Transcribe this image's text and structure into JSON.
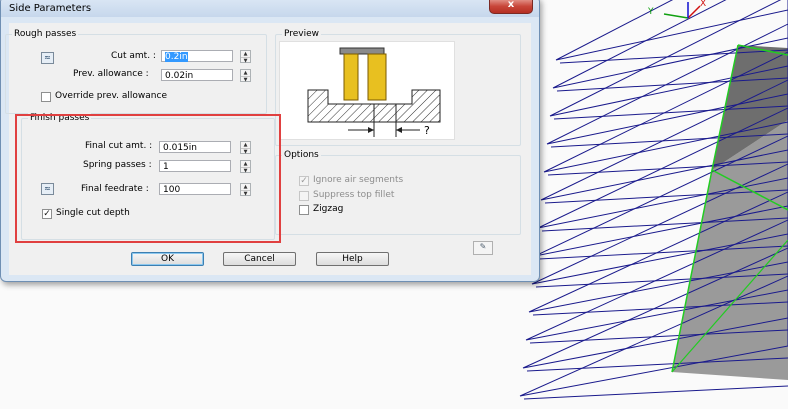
{
  "dialog": {
    "title": "Side Parameters",
    "close_label": "x"
  },
  "rough": {
    "title": "Rough passes",
    "cut_amt_label": "Cut amt. :",
    "cut_amt_value": "0.2in",
    "prev_allowance_label": "Prev. allowance :",
    "prev_allowance_value": "0.02in",
    "override_label": "Override prev. allowance",
    "override_checked": false
  },
  "preview": {
    "title": "Preview",
    "question_mark": "?"
  },
  "finish": {
    "title": "Finish passes",
    "final_cut_label": "Final cut amt. :",
    "final_cut_value": "0.015in",
    "spring_label": "Spring passes :",
    "spring_value": "1",
    "feedrate_label": "Final feedrate :",
    "feedrate_value": "100",
    "single_cut_label": "Single cut depth",
    "single_cut_checked": true
  },
  "options": {
    "title": "Options",
    "ignore_air_label": "Ignore air segments",
    "ignore_air_checked": true,
    "suppress_fillet_label": "Suppress top fillet",
    "suppress_fillet_checked": false,
    "zigzag_label": "Zigzag",
    "zigzag_checked": false
  },
  "buttons": {
    "ok": "OK",
    "cancel": "Cancel",
    "help": "Help"
  },
  "axes": {
    "y": "Y",
    "x": "X"
  },
  "colors": {
    "highlight": "#e04040",
    "toolpath": "#1a1a8c",
    "edge": "#22cc22"
  }
}
